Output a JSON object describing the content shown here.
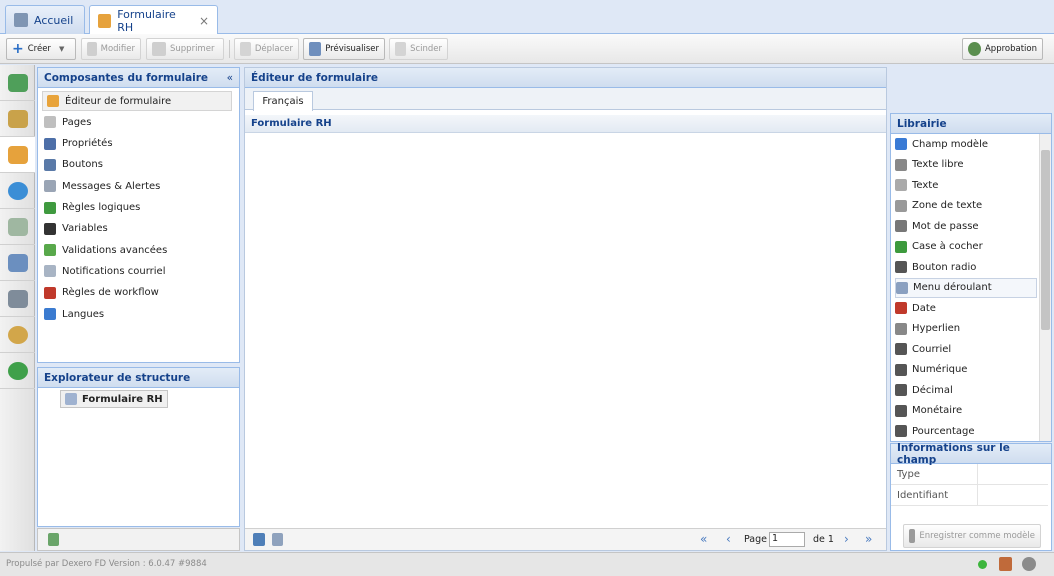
{
  "tabs": [
    {
      "label": "Accueil",
      "icon": "home-icon"
    },
    {
      "label": "Formulaire RH",
      "icon": "form-edit-icon",
      "close": "×"
    }
  ],
  "toolbar": {
    "create": "Créer",
    "modify": "Modifier",
    "delete": "Supprimer",
    "move": "Déplacer",
    "preview": "Prévisualiser",
    "split": "Scinder",
    "approval": "Approbation"
  },
  "rail": [
    "recycle-icon",
    "eraser-icon",
    "form-icon",
    "globe-icon",
    "image-icon",
    "database-icon",
    "tools-icon",
    "clock-icon",
    "earth-icon"
  ],
  "components": {
    "title": "Composantes du formulaire",
    "collapse": "«",
    "items": [
      {
        "label": "Éditeur de formulaire",
        "icon": "form-edit-icon",
        "color": "#e8a33a"
      },
      {
        "label": "Pages",
        "icon": "page-icon",
        "color": "#bfbfbf"
      },
      {
        "label": "Propriétés",
        "icon": "properties-icon",
        "color": "#4d6fa8"
      },
      {
        "label": "Boutons",
        "icon": "button-icon",
        "color": "#5a7aa8"
      },
      {
        "label": "Messages & Alertes",
        "icon": "message-icon",
        "color": "#9aa5b5"
      },
      {
        "label": "Règles logiques",
        "icon": "logic-icon",
        "color": "#3f9a3f"
      },
      {
        "label": "Variables",
        "icon": "sqrt-icon",
        "color": "#333333"
      },
      {
        "label": "Validations avancées",
        "icon": "validation-icon",
        "color": "#58a84b"
      },
      {
        "label": "Notifications courriel",
        "icon": "email-icon",
        "color": "#a8b4c4"
      },
      {
        "label": "Règles de workflow",
        "icon": "workflow-icon",
        "color": "#c0392b"
      },
      {
        "label": "Langues",
        "icon": "language-icon",
        "color": "#3b7bd0"
      }
    ]
  },
  "explorer": {
    "title": "Explorateur de structure",
    "root": "Formulaire RH"
  },
  "editor": {
    "title": "Éditeur de formulaire",
    "lang_tab": "Français",
    "form_title": "Formulaire RH",
    "pager": {
      "page_label": "Page",
      "page_value": "1",
      "of_label": "de 1"
    }
  },
  "library": {
    "title": "Librairie",
    "items": [
      {
        "label": "Champ modèle",
        "icon": "template-field-icon",
        "color": "#3a7bd5"
      },
      {
        "label": "Texte libre",
        "icon": "free-text-icon",
        "color": "#888888"
      },
      {
        "label": "Texte",
        "icon": "text-icon",
        "color": "#aaaaaa"
      },
      {
        "label": "Zone de texte",
        "icon": "textarea-icon",
        "color": "#999999"
      },
      {
        "label": "Mot de passe",
        "icon": "lock-icon",
        "color": "#777777"
      },
      {
        "label": "Case à cocher",
        "icon": "checkbox-icon",
        "color": "#3d9a3d"
      },
      {
        "label": "Bouton radio",
        "icon": "radio-icon",
        "color": "#555555"
      },
      {
        "label": "Menu déroulant",
        "icon": "dropdown-icon",
        "color": "#8aa0c0"
      },
      {
        "label": "Date",
        "icon": "calendar-icon",
        "color": "#c0392b"
      },
      {
        "label": "Hyperlien",
        "icon": "link-icon",
        "color": "#888888"
      },
      {
        "label": "Courriel",
        "icon": "at-icon",
        "color": "#555555"
      },
      {
        "label": "Numérique",
        "icon": "number-icon",
        "color": "#555555"
      },
      {
        "label": "Décimal",
        "icon": "decimal-icon",
        "color": "#555555"
      },
      {
        "label": "Monétaire",
        "icon": "dollar-icon",
        "color": "#555555"
      },
      {
        "label": "Pourcentage",
        "icon": "percent-icon",
        "color": "#555555"
      }
    ]
  },
  "fieldinfo": {
    "title": "Informations sur le champ",
    "type_label": "Type",
    "id_label": "Identifiant",
    "save_template": "Enregistrer comme modèle"
  },
  "status": {
    "text": "Propulsé par Dexero FD Version : 6.0.47 #9884"
  }
}
